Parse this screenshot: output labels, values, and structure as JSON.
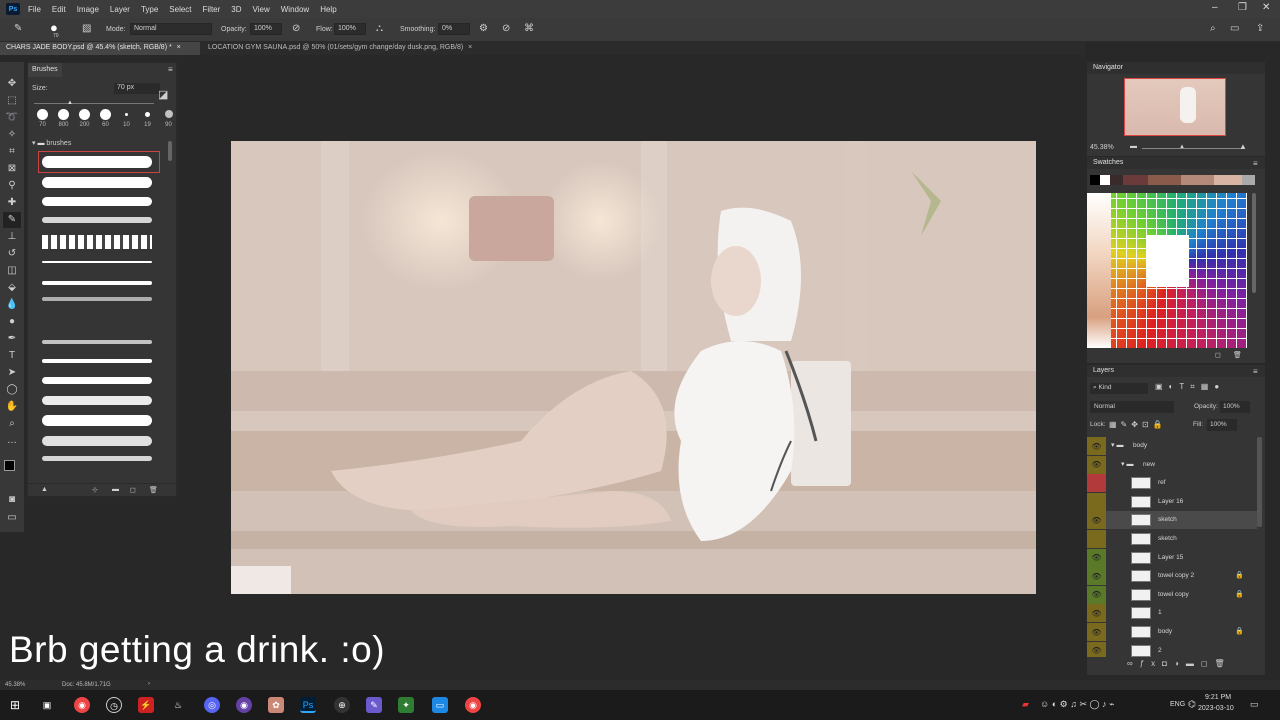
{
  "menubar": {
    "logo": "Ps",
    "items": [
      "File",
      "Edit",
      "Image",
      "Layer",
      "Type",
      "Select",
      "Filter",
      "3D",
      "View",
      "Window",
      "Help"
    ]
  },
  "options": {
    "mode_label": "Mode:",
    "mode_value": "Normal",
    "opacity_label": "Opacity:",
    "opacity_value": "100%",
    "flow_label": "Flow:",
    "flow_value": "100%",
    "smoothing_label": "Smoothing:",
    "smoothing_value": "0%",
    "brush_size": "70"
  },
  "tabs": [
    {
      "label": "CHARS JADE BODY.psd @ 45.4% (sketch, RGB/8) *",
      "close": "×"
    },
    {
      "label": "LOCATION GYM SAUNA.psd @ 50% (01/sets/gym change/day dusk.png, RGB/8)",
      "close": "×"
    }
  ],
  "brushes": {
    "title": "Brushes",
    "size_label": "Size:",
    "size_value": "70 px",
    "sizes": [
      "70",
      "800",
      "200",
      "60",
      "10",
      "19",
      "90"
    ],
    "folder_label": "brushes"
  },
  "navigator": {
    "title": "Navigator",
    "zoom": "45.38%"
  },
  "swatches": {
    "title": "Swatches"
  },
  "layers": {
    "title": "Layers",
    "filter_label": "Kind",
    "blend_mode": "Normal",
    "opacity_label": "Opacity:",
    "opacity_value": "100%",
    "lock_label": "Lock:",
    "fill_label": "Fill:",
    "fill_value": "100%",
    "rows": [
      {
        "name": "body",
        "type": "group",
        "color": "#7a6a1e",
        "visible": true,
        "indent": 0
      },
      {
        "name": "new",
        "type": "group",
        "color": "#7a6a1e",
        "visible": true,
        "indent": 1
      },
      {
        "name": "ref",
        "type": "layer",
        "color": "#b23a3a",
        "visible": false,
        "locked": false
      },
      {
        "name": "Layer 16",
        "type": "layer",
        "color": "#7a6a1e",
        "visible": false,
        "locked": false
      },
      {
        "name": "sketch",
        "type": "layer",
        "color": "#7a6a1e",
        "visible": true,
        "locked": false,
        "selected": true
      },
      {
        "name": "sketch",
        "type": "layer",
        "color": "#7a6a1e",
        "visible": false,
        "locked": false
      },
      {
        "name": "Layer 15",
        "type": "layer",
        "color": "#5a7a2a",
        "visible": true,
        "locked": false
      },
      {
        "name": "towel copy 2",
        "type": "layer",
        "color": "#5a7a2a",
        "visible": true,
        "locked": true
      },
      {
        "name": "towel copy",
        "type": "layer",
        "color": "#5a7a2a",
        "visible": true,
        "locked": true
      },
      {
        "name": "1",
        "type": "layer",
        "color": "#7a6a1e",
        "visible": true,
        "locked": false
      },
      {
        "name": "body",
        "type": "layer",
        "color": "#7a6a1e",
        "visible": true,
        "locked": true
      },
      {
        "name": "2",
        "type": "layer",
        "color": "#7a6a1e",
        "visible": true,
        "locked": false
      }
    ]
  },
  "subtitle": "Brb getting a drink. :o)",
  "status": {
    "zoom": "45.38%",
    "doc": "Doc: 45.8M/1.71G"
  },
  "taskbar": {
    "lang": "ENG",
    "time": "9:21 PM",
    "date": "2023-03-10"
  }
}
